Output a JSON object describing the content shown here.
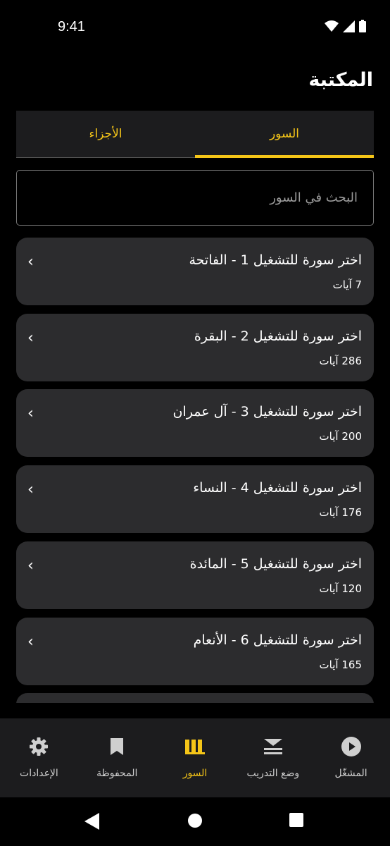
{
  "status": {
    "time": "9:41"
  },
  "page": {
    "title": "المكتبة"
  },
  "tabs": [
    {
      "label": "السور",
      "active": true
    },
    {
      "label": "الأجزاء",
      "active": false
    }
  ],
  "search": {
    "placeholder": "البحث في السور",
    "value": ""
  },
  "surahs": [
    {
      "title": "اختر سورة للتشغيل 1 - الفاتحة",
      "ayat": "7 آيات"
    },
    {
      "title": "اختر سورة للتشغيل 2 - البقرة",
      "ayat": "286 آيات"
    },
    {
      "title": "اختر سورة للتشغيل 3 - آل عمران",
      "ayat": "200 آيات"
    },
    {
      "title": "اختر سورة للتشغيل 4 - النساء",
      "ayat": "176 آيات"
    },
    {
      "title": "اختر سورة للتشغيل 5 - المائدة",
      "ayat": "120 آيات"
    },
    {
      "title": "اختر سورة للتشغيل 6 - الأنعام",
      "ayat": "165 آيات"
    }
  ],
  "chevron": "›",
  "nav": [
    {
      "label": "المشغّل",
      "icon": "play-circle-icon",
      "active": false
    },
    {
      "label": "وضع التدريب",
      "icon": "practice-stack-icon",
      "active": false
    },
    {
      "label": "السور",
      "icon": "library-bars-icon",
      "active": true
    },
    {
      "label": "المحفوظة",
      "icon": "bookmark-icon",
      "active": false
    },
    {
      "label": "الإعدادات",
      "icon": "gear-icon",
      "active": false
    }
  ],
  "colors": {
    "accent": "#f5c518",
    "card": "#2c2c2e",
    "surface": "#1c1c1e",
    "background": "#000000"
  }
}
